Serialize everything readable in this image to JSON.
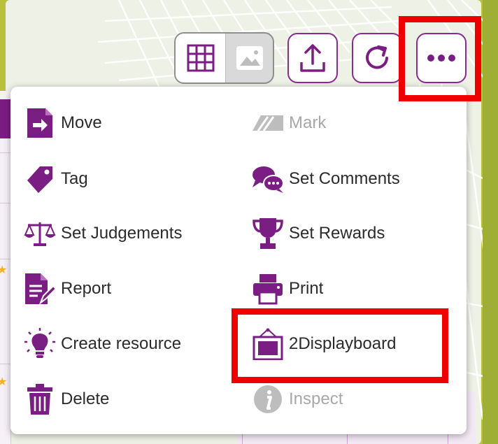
{
  "toolbar": {
    "grid_view": "grid-view-icon",
    "image_view": "image-view-icon",
    "share": "share-icon",
    "refresh": "refresh-icon",
    "more": "more-options-icon"
  },
  "menu": {
    "left": [
      {
        "label": "Move",
        "icon": "move-file-icon",
        "enabled": true
      },
      {
        "label": "Tag",
        "icon": "tag-icon",
        "enabled": true
      },
      {
        "label": "Set Judgements",
        "icon": "scales-icon",
        "enabled": true
      },
      {
        "label": "Report",
        "icon": "report-icon",
        "enabled": true
      },
      {
        "label": "Create resource",
        "icon": "lightbulb-icon",
        "enabled": true
      },
      {
        "label": "Delete",
        "icon": "trash-icon",
        "enabled": true
      }
    ],
    "right": [
      {
        "label": "Mark",
        "icon": "mark-icon",
        "enabled": false
      },
      {
        "label": "Set Comments",
        "icon": "comments-icon",
        "enabled": true
      },
      {
        "label": "Set Rewards",
        "icon": "trophy-icon",
        "enabled": true
      },
      {
        "label": "Print",
        "icon": "printer-icon",
        "enabled": true
      },
      {
        "label": "2Displayboard",
        "icon": "displayboard-icon",
        "enabled": true
      },
      {
        "label": "Inspect",
        "icon": "info-icon",
        "enabled": false
      }
    ]
  },
  "colors": {
    "accent": "#7b1e84",
    "highlight": "#ee0000",
    "disabled": "#a8a8a8"
  }
}
